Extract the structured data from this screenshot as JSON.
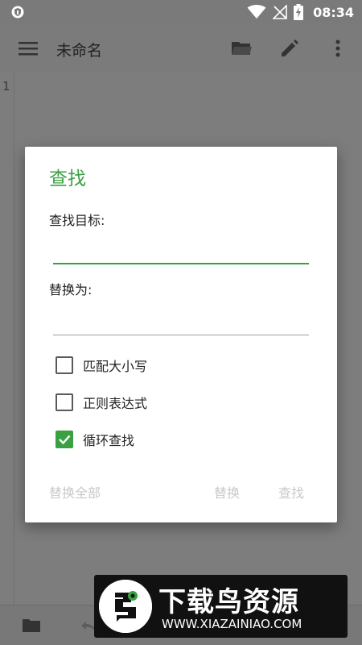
{
  "status_bar": {
    "time": "08:34"
  },
  "app_bar": {
    "title": "未命名"
  },
  "editor": {
    "line_numbers": [
      "1"
    ]
  },
  "dialog": {
    "title": "查找",
    "find_label": "查找目标:",
    "find_value": "",
    "replace_label": "替换为:",
    "replace_value": "",
    "options": [
      {
        "label": "匹配大小写",
        "checked": false
      },
      {
        "label": "正则表达式",
        "checked": false
      },
      {
        "label": "循环查找",
        "checked": true
      }
    ],
    "buttons": {
      "replace_all": "替换全部",
      "replace": "替换",
      "find": "查找"
    }
  },
  "watermark": {
    "title": "下载鸟资源",
    "url": "WWW.XIAZAINIAO.COM"
  },
  "colors": {
    "accent": "#3aa142",
    "disabled_text": "#c8c8c8",
    "scrim_bg": "#7d7d7d"
  },
  "icons": {
    "status_left": "shield-icon",
    "wifi": "wifi-icon",
    "no_signal": "no-signal-icon",
    "battery": "battery-charging-icon",
    "menu": "menu-icon",
    "open_folder": "folder-open-icon",
    "edit": "pencil-icon",
    "more": "more-vert-icon",
    "bottom_folder": "folder-icon",
    "undo": "undo-icon"
  }
}
